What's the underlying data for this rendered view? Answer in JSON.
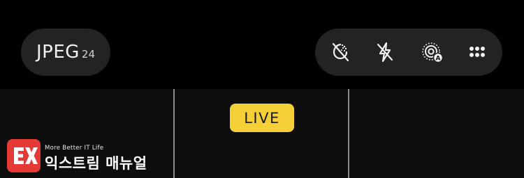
{
  "format": {
    "type": "JPEG",
    "resolution": "24"
  },
  "tools": [
    {
      "icon": "macro-off-icon"
    },
    {
      "icon": "flash-off-icon"
    },
    {
      "icon": "live-photo-auto-icon",
      "badge": "A"
    },
    {
      "icon": "more-grid-icon"
    }
  ],
  "live_badge": {
    "label": "LIVE"
  },
  "watermark": {
    "tagline": "More Better IT Life",
    "name": "익스트림 매뉴얼"
  },
  "colors": {
    "live_yellow": "#f5cf37",
    "pill_bg": "#232325",
    "viewfinder_bg": "#0e0e0f",
    "watermark_red": "#e53935"
  }
}
